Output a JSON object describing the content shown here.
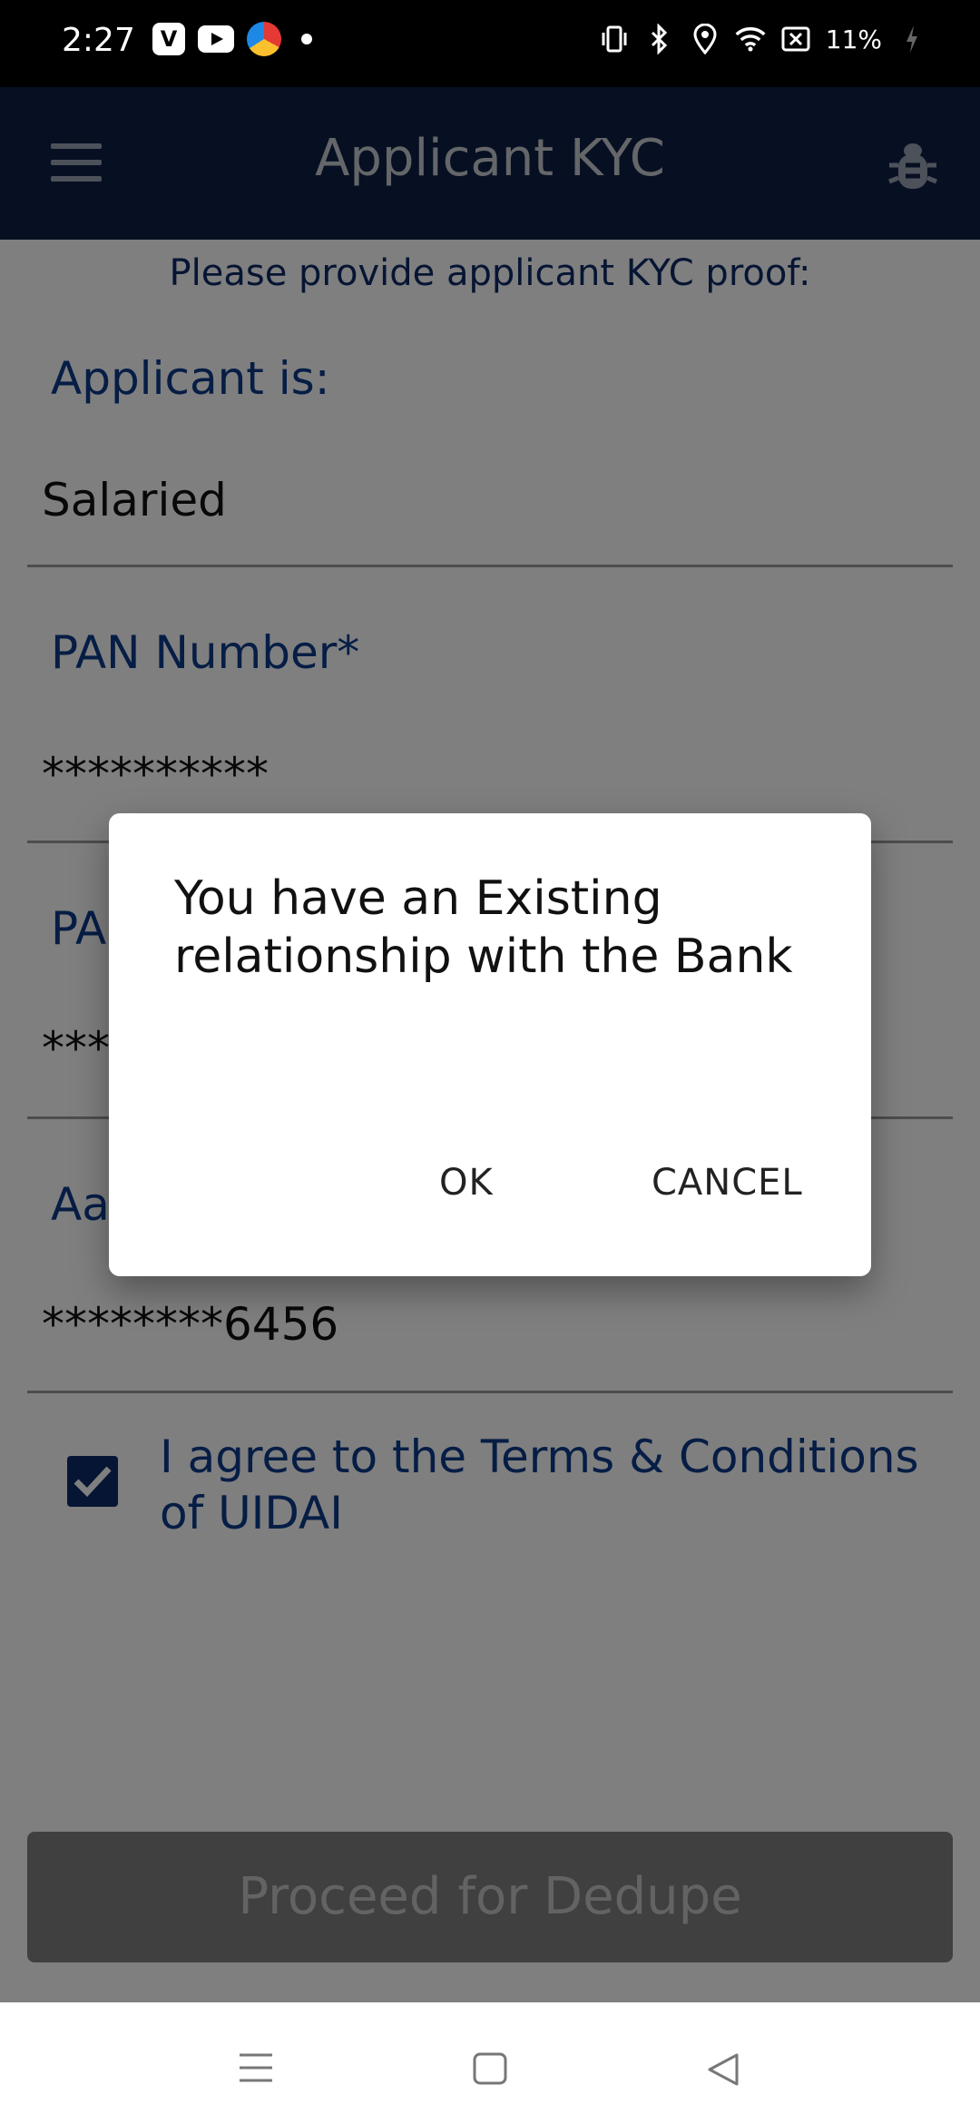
{
  "status_bar": {
    "time": "2:27",
    "battery": "11%",
    "left_icons": [
      "vimeo-icon",
      "youtube-icon",
      "browser-icon",
      "dot-icon"
    ],
    "right_icons": [
      "vibrate-icon",
      "bluetooth-icon",
      "location-icon",
      "wifi-icon",
      "screenshot-off-icon",
      "battery-icon"
    ]
  },
  "app_bar": {
    "title": "Applicant KYC",
    "menu_icon": "hamburger-menu-icon",
    "action_icon": "bug-icon"
  },
  "form": {
    "subtitle": "Please provide applicant KYC proof:",
    "applicant_is_label": "Applicant is:",
    "applicant_is_value": "Salaried",
    "pan_label": "PAN Number*",
    "pan_value": "**********",
    "pan_confirm_label_partial": "PA",
    "pan_confirm_value_partial": "***",
    "aadhaar_label_partial": "Aa",
    "aadhaar_value": "********6456",
    "terms_checked": true,
    "terms_text": "I agree to the Terms & Conditions of UIDAI",
    "proceed_button": "Proceed for Dedupe"
  },
  "dialog": {
    "message": "You have an Existing relationship with the Bank",
    "ok": "OK",
    "cancel": "CANCEL"
  },
  "nav_bar": {
    "icons": [
      "recents-icon",
      "home-icon",
      "back-icon"
    ]
  },
  "colors": {
    "app_bar": "#0d2145",
    "accent": "#0d3a8a",
    "scrim": "rgba(0,0,0,0.5)"
  }
}
